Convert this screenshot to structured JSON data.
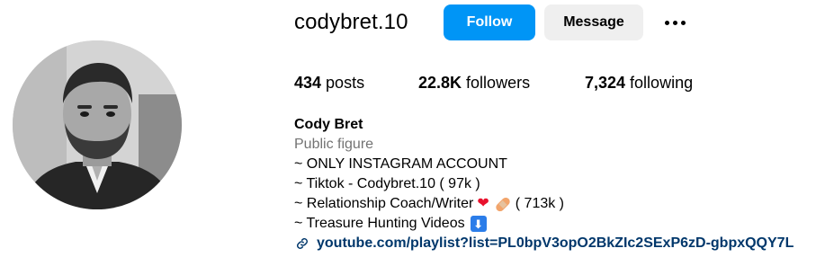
{
  "profile": {
    "username": "codybret.10",
    "follow_label": "Follow",
    "message_label": "Message",
    "more_icon": "more-horizontal-icon"
  },
  "stats": {
    "posts_count": "434",
    "posts_label": " posts",
    "followers_count": "22.8K",
    "followers_label": " followers",
    "following_count": "7,324",
    "following_label": " following"
  },
  "bio": {
    "name": "Cody Bret",
    "category": "Public figure",
    "line1": "~ ONLY INSTAGRAM ACCOUNT",
    "line2": "~ Tiktok - Codybret.10 ( 97k )",
    "line3_text": "~ Relationship Coach/Writer",
    "line3_tail": "( 713k )",
    "line4_text": "~ Treasure Hunting Videos",
    "heart_emoji": "❤",
    "arrow_emoji": "⬇",
    "link_text": "youtube.com/playlist?list=PL0bpV3opO2BkZIc2SExP6zD-gbpxQQY7L"
  },
  "colors": {
    "follow_button": "#0095f6",
    "message_button": "#efefef",
    "category_text": "#737373",
    "link_text": "#00376b"
  }
}
